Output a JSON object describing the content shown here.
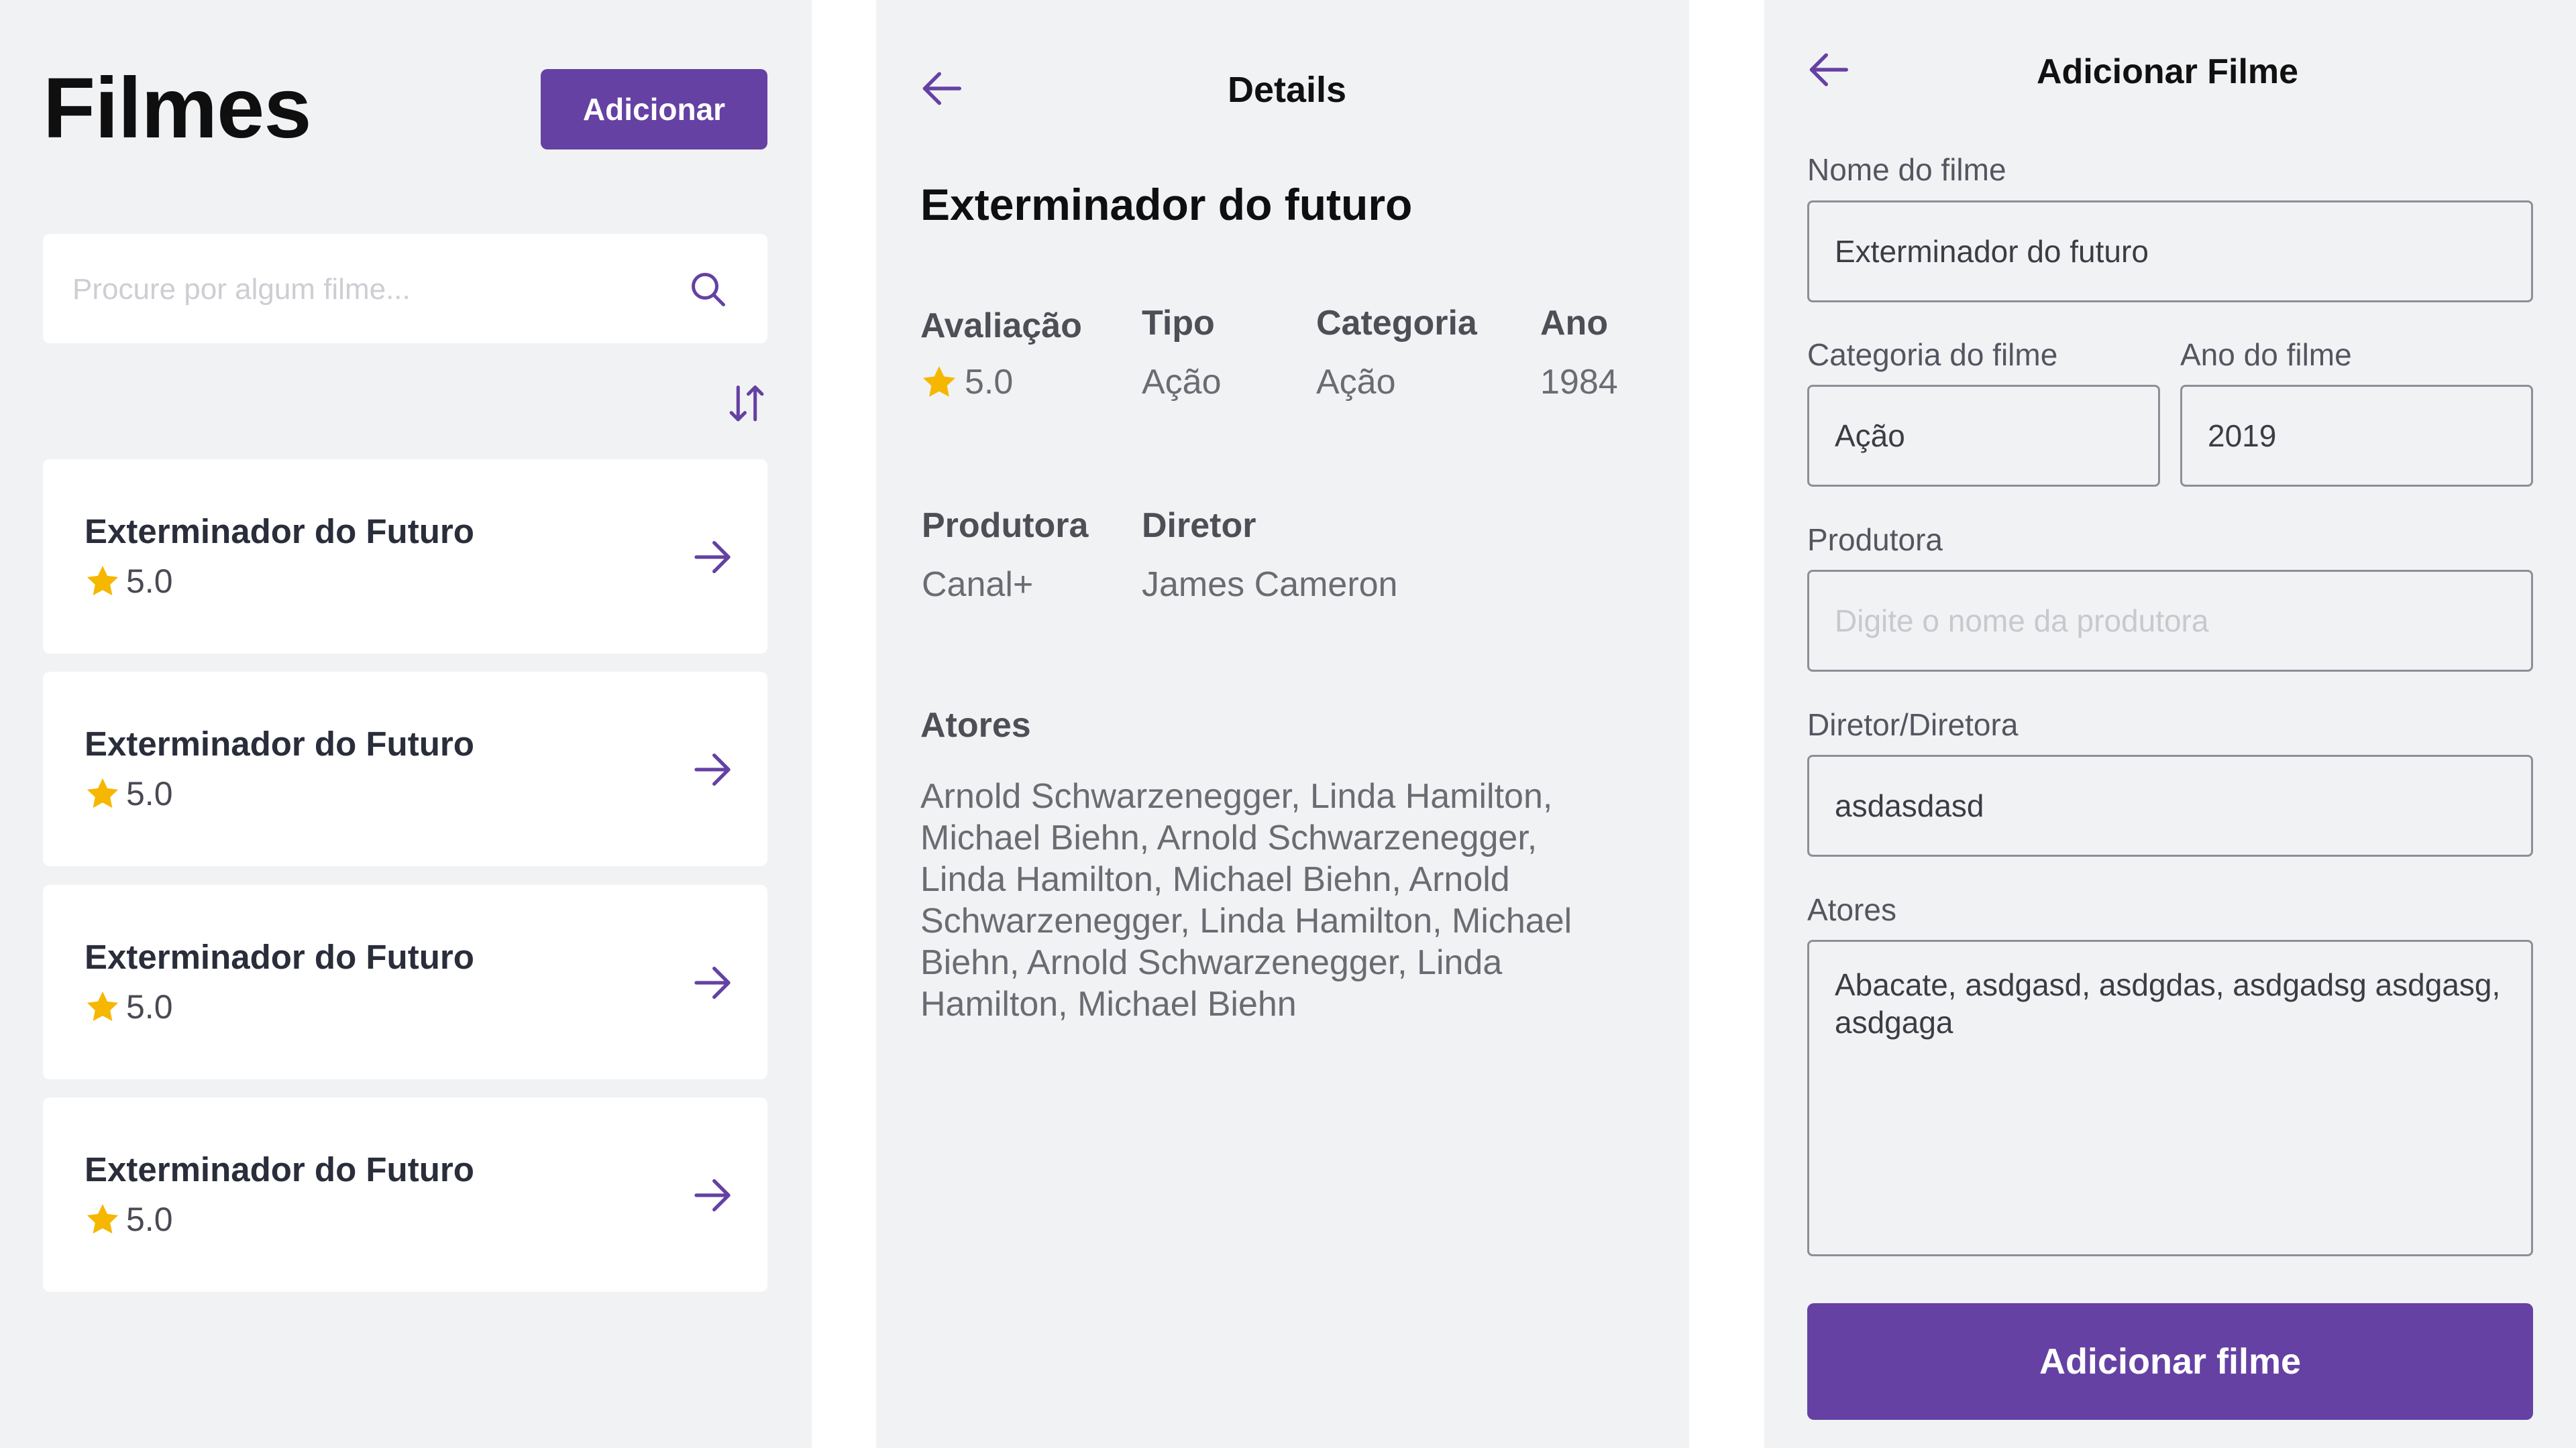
{
  "accent_color": "#6541a3",
  "star_color": "#f5b700",
  "list_screen": {
    "title": "Filmes",
    "add_button": "Adicionar",
    "search": {
      "placeholder": "Procure por algum filme...",
      "icon": "search-icon"
    },
    "sort_icon": "sort-icon",
    "movies": [
      {
        "name": "Exterminador do Futuro",
        "rating": "5.0"
      },
      {
        "name": "Exterminador do Futuro",
        "rating": "5.0"
      },
      {
        "name": "Exterminador do Futuro",
        "rating": "5.0"
      },
      {
        "name": "Exterminador do Futuro",
        "rating": "5.0"
      }
    ]
  },
  "details_screen": {
    "header": "Details",
    "movie_title": "Exterminador do futuro",
    "labels": {
      "rating": "Avaliação",
      "type": "Tipo",
      "category": "Categoria",
      "year": "Ano",
      "producer": "Produtora",
      "director": "Diretor",
      "actors": "Atores"
    },
    "values": {
      "rating": "5.0",
      "type": "Ação",
      "category": "Ação",
      "year": "1984",
      "producer": "Canal+",
      "director": "James Cameron",
      "actors": "Arnold Schwarzenegger, Linda Hamilton, Michael Biehn, Arnold Schwarzenegger, Linda Hamilton, Michael Biehn, Arnold Schwarzenegger, Linda Hamilton, Michael Biehn, Arnold Schwarzenegger, Linda Hamilton, Michael Biehn"
    }
  },
  "add_screen": {
    "header": "Adicionar Filme",
    "fields": {
      "name": {
        "label": "Nome do filme",
        "value": "Exterminador do futuro"
      },
      "category": {
        "label": "Categoria do filme",
        "value": "Ação"
      },
      "year": {
        "label": "Ano do filme",
        "value": "2019"
      },
      "producer": {
        "label": "Produtora",
        "value": "",
        "placeholder": "Digite o nome da produtora"
      },
      "director": {
        "label": "Diretor/Diretora",
        "value": "asdasdasd"
      },
      "actors": {
        "label": "Atores",
        "value": "Abacate, asdgasd, asdgdas, asdgadsg asdgasg, asdgaga"
      }
    },
    "submit_button": "Adicionar filme"
  }
}
